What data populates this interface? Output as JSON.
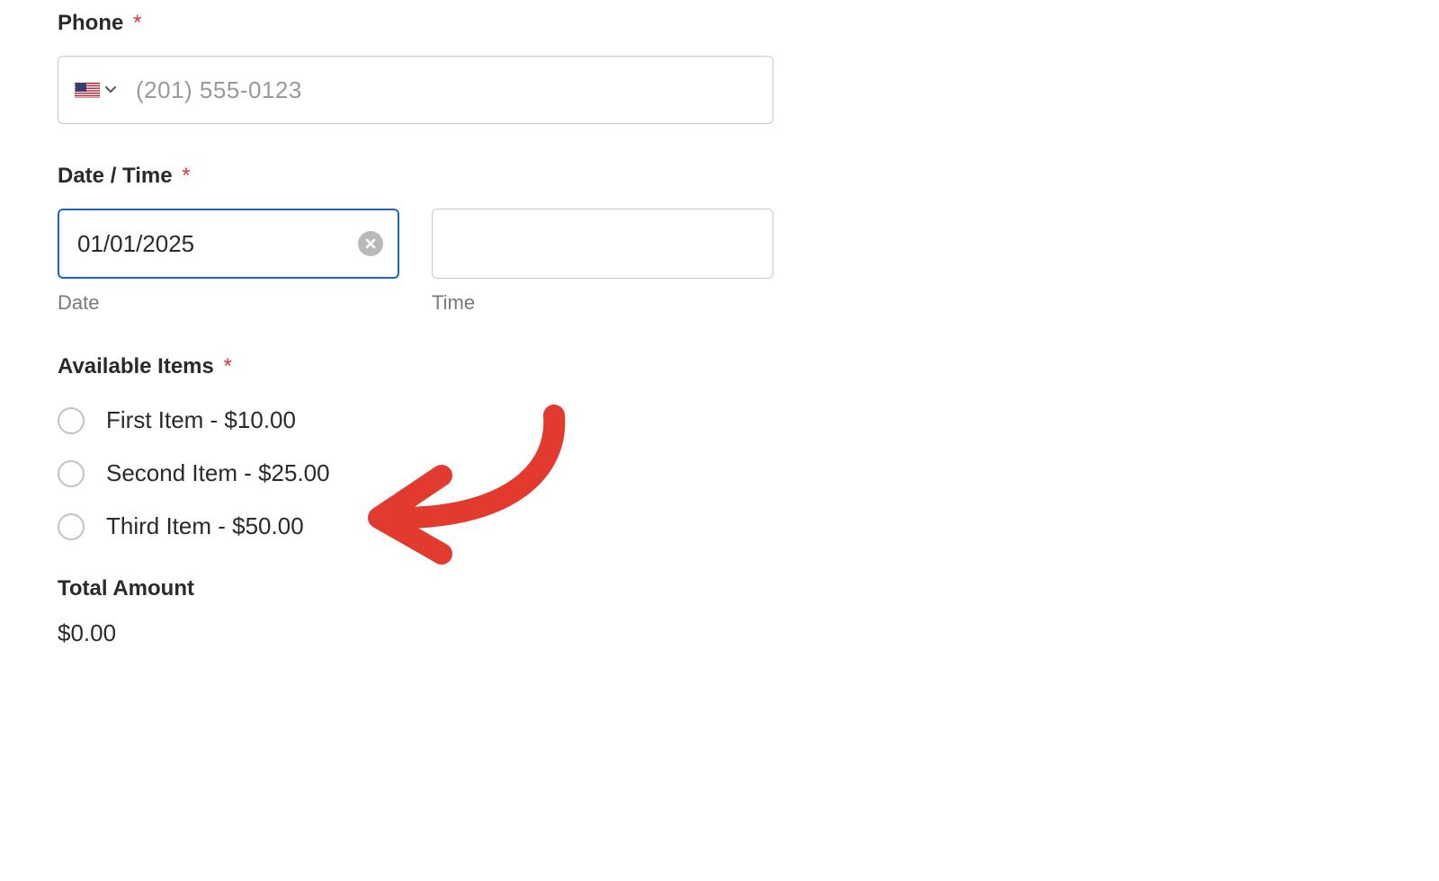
{
  "required_mark": "*",
  "phone": {
    "label": "Phone",
    "placeholder": "(201) 555-0123",
    "country": "US"
  },
  "datetime": {
    "label": "Date / Time",
    "date_value": "01/01/2025",
    "date_sublabel": "Date",
    "time_sublabel": "Time"
  },
  "items": {
    "label": "Available Items",
    "options": [
      "First Item - $10.00",
      "Second Item - $25.00",
      "Third Item - $50.00"
    ]
  },
  "total": {
    "label": "Total Amount",
    "value": "$0.00"
  }
}
